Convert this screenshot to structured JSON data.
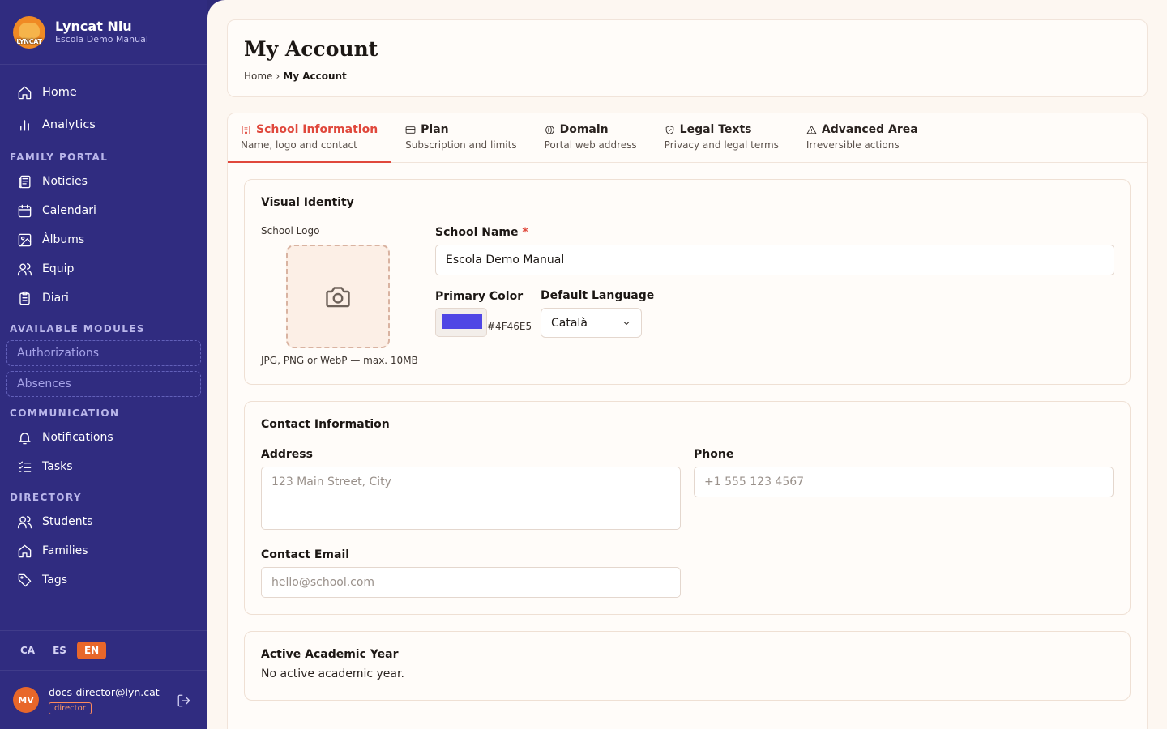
{
  "app": {
    "name": "Lyncat Niu",
    "school": "Escola Demo Manual",
    "logo_text": "LYNCAT"
  },
  "sidebar": {
    "top_items": [
      {
        "label": "Home",
        "icon": "home-icon"
      },
      {
        "label": "Analytics",
        "icon": "bar-chart-icon"
      }
    ],
    "sections": {
      "family_portal": {
        "title": "Family Portal",
        "items": [
          {
            "label": "Noticies",
            "icon": "newspaper-icon"
          },
          {
            "label": "Calendari",
            "icon": "calendar-icon"
          },
          {
            "label": "Àlbums",
            "icon": "image-icon"
          },
          {
            "label": "Equip",
            "icon": "users-icon"
          },
          {
            "label": "Diari",
            "icon": "clipboard-icon"
          }
        ]
      },
      "available_modules": {
        "title": "Available Modules",
        "items": [
          {
            "label": "Authorizations"
          },
          {
            "label": "Absences"
          }
        ]
      },
      "communication": {
        "title": "Communication",
        "items": [
          {
            "label": "Notifications",
            "icon": "bell-icon"
          },
          {
            "label": "Tasks",
            "icon": "list-checks-icon"
          }
        ]
      },
      "directory": {
        "title": "Directory",
        "items": [
          {
            "label": "Students",
            "icon": "users-icon"
          },
          {
            "label": "Families",
            "icon": "home-icon"
          },
          {
            "label": "Tags",
            "icon": "tag-icon"
          }
        ]
      }
    },
    "languages": [
      "CA",
      "ES",
      "EN"
    ],
    "active_language": "EN",
    "user": {
      "initials": "MV",
      "email": "docs-director@lyn.cat",
      "role": "director"
    }
  },
  "header": {
    "title": "My Account",
    "breadcrumb": {
      "home": "Home",
      "separator": "›",
      "current": "My Account"
    }
  },
  "tabs": [
    {
      "label": "School Information",
      "sub": "Name, logo and contact",
      "icon": "building-icon",
      "active": true
    },
    {
      "label": "Plan",
      "sub": "Subscription and limits",
      "icon": "credit-card-icon"
    },
    {
      "label": "Domain",
      "sub": "Portal web address",
      "icon": "globe-icon"
    },
    {
      "label": "Legal Texts",
      "sub": "Privacy and legal terms",
      "icon": "shield-check-icon"
    },
    {
      "label": "Advanced Area",
      "sub": "Irreversible actions",
      "icon": "warning-icon"
    }
  ],
  "visual_identity": {
    "title": "Visual Identity",
    "logo_label": "School Logo",
    "logo_hint": "JPG, PNG or WebP — max. 10MB",
    "school_name_label": "School Name",
    "required_mark": "*",
    "school_name_value": "Escola Demo Manual",
    "primary_color_label": "Primary Color",
    "primary_color_value": "#4F46E5",
    "default_language_label": "Default Language",
    "default_language_value": "Català"
  },
  "contact": {
    "title": "Contact Information",
    "address_label": "Address",
    "address_placeholder": "123 Main Street, City",
    "phone_label": "Phone",
    "phone_placeholder": "+1 555 123 4567",
    "email_label": "Contact Email",
    "email_placeholder": "hello@school.com"
  },
  "academic": {
    "title": "Active Academic Year",
    "value": "No active academic year."
  },
  "colors": {
    "sidebar": "#302C80",
    "accent": "#E0483C",
    "brand_orange": "#E8672A",
    "primary": "#4F46E5",
    "background": "#FDF7F1"
  }
}
